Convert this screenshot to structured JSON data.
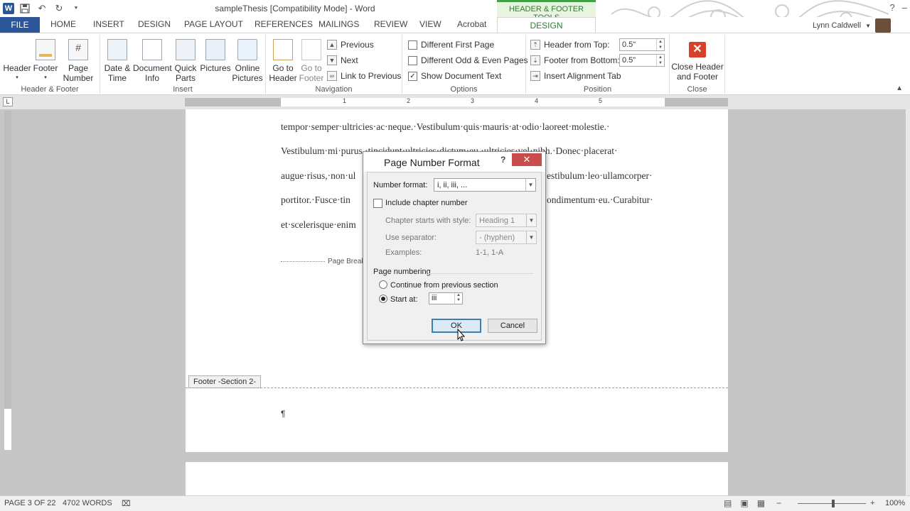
{
  "window": {
    "title": "sampleThesis [Compatibility Mode] - Word",
    "context_tab_group": "HEADER & FOOTER TOOLS",
    "user_name": "Lynn Caldwell",
    "controls": {
      "help": "?",
      "minimize": "–"
    }
  },
  "qat": {
    "app_icon": "W",
    "undo_icon": "↶",
    "redo_icon": "↻",
    "more_icon": "⯆"
  },
  "tabs": {
    "file": "FILE",
    "items": [
      "HOME",
      "INSERT",
      "DESIGN",
      "PAGE LAYOUT",
      "REFERENCES",
      "MAILINGS",
      "REVIEW",
      "VIEW",
      "Acrobat"
    ],
    "active": "DESIGN"
  },
  "ribbon": {
    "header_footer": {
      "label": "Header & Footer",
      "header": "Header",
      "footer": "Footer",
      "page_number_l1": "Page",
      "page_number_l2": "Number"
    },
    "insert": {
      "label": "Insert",
      "date_l1": "Date &",
      "date_l2": "Time",
      "docinfo_l1": "Document",
      "docinfo_l2": "Info",
      "quickparts_l1": "Quick",
      "quickparts_l2": "Parts",
      "pictures": "Pictures",
      "online_l1": "Online",
      "online_l2": "Pictures"
    },
    "navigation": {
      "label": "Navigation",
      "goto_header_l1": "Go to",
      "goto_header_l2": "Header",
      "goto_footer_l1": "Go to",
      "goto_footer_l2": "Footer",
      "previous": "Previous",
      "next": "Next",
      "link_previous": "Link to Previous"
    },
    "options": {
      "label": "Options",
      "diff_first": "Different First Page",
      "diff_odd_even": "Different Odd & Even Pages",
      "show_doc_text": "Show Document Text",
      "show_doc_text_checked": true
    },
    "position": {
      "label": "Position",
      "header_from_top": "Header from Top:",
      "header_value": "0.5\"",
      "footer_from_bottom": "Footer from Bottom:",
      "footer_value": "0.5\"",
      "insert_alignment_tab": "Insert Alignment Tab"
    },
    "close": {
      "label": "Close",
      "close_l1": "Close Header",
      "close_l2": "and Footer"
    }
  },
  "ruler": {
    "corner": "L",
    "numbers": [
      "1",
      "2",
      "3",
      "4",
      "5"
    ]
  },
  "document": {
    "lines": [
      "tempor·semper·ultricies·ac·neque.·Vestibulum·quis·mauris·at·odio·laoreet·molestie.·",
      "Vestibulum·mi·purus,·tincidunt·ultricies·dictum·eu,·ultricies·vel·nibh.·Donec·placerat·",
      "augue·risus,·non·ul",
      "portitor.·Fusce·tin",
      "et·scelerisque·enim"
    ],
    "line3_right": "estibulum·leo·ullamcorper·",
    "line4_right": "ondimentum·eu.·Curabitur·",
    "page_break": "Page Break",
    "footer_tag": "Footer -Section 2-",
    "pilcrow": "¶"
  },
  "dialog": {
    "title": "Page Number Format",
    "help": "?",
    "close": "✕",
    "number_format_label": "Number format:",
    "number_format_value": "i, ii, iii, ...",
    "include_chapter": "Include chapter number",
    "chapter_style_label": "Chapter starts with style:",
    "chapter_style_value": "Heading 1",
    "separator_label": "Use separator:",
    "separator_value": "-   (hyphen)",
    "examples_label": "Examples:",
    "examples_value": "1-1, 1-A",
    "page_numbering": "Page numbering",
    "continue_label": "Continue from previous section",
    "start_at_label": "Start at:",
    "start_at_value": "iii",
    "ok": "OK",
    "cancel": "Cancel",
    "selected_option": "start_at"
  },
  "status": {
    "page": "PAGE 3 OF 22",
    "words": "4702 WORDS",
    "zoom": "100%"
  }
}
